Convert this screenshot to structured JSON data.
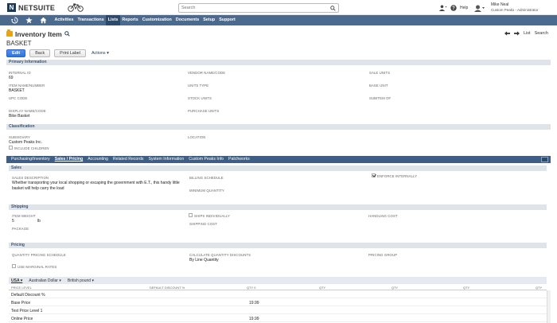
{
  "brand": {
    "name": "NETSUITE",
    "mark": "N"
  },
  "search": {
    "placeholder": "Search",
    "value": ""
  },
  "help": {
    "label": "Help"
  },
  "user": {
    "name": "Mike Neal",
    "role": "Custom Peaks - Administrator"
  },
  "nav": {
    "items": [
      "Activities",
      "Transactions",
      "Lists",
      "Reports",
      "Customization",
      "Documents",
      "Setup",
      "Support"
    ],
    "active": "Lists"
  },
  "page": {
    "title": "Inventory Item",
    "record_name": "BASKET",
    "list_link": "List",
    "search_link": "Search"
  },
  "buttons": {
    "edit": "Edit",
    "back": "Back",
    "print_label": "Print Label",
    "actions": "Actions ▾"
  },
  "primary": {
    "heading": "Primary Information",
    "internal_id_label": "INTERNAL ID",
    "internal_id_value": "69",
    "item_name_label": "ITEM NAME/NUMBER",
    "item_name_value": "BASKET",
    "upc_label": "UPC CODE",
    "display_name_label": "DISPLAY NAME/CODE",
    "display_name_value": "Bike Basket",
    "vendor_name_label": "VENDOR NAME/CODE",
    "units_type_label": "UNITS TYPE",
    "stock_units_label": "STOCK UNITS",
    "purchase_units_label": "PURCHASE UNITS",
    "sale_units_label": "SALE UNITS",
    "base_unit_label": "BASE UNIT",
    "subitem_of_label": "SUBITEM OF"
  },
  "classification": {
    "heading": "Classification",
    "subsidiary_label": "SUBSIDIARY",
    "subsidiary_value": "Custom Peaks Inc.",
    "include_children_label": "INCLUDE CHILDREN",
    "location_label": "LOCATION"
  },
  "subtabs": {
    "items": [
      "Purchasing/Inventory",
      "Sales / Pricing",
      "Accounting",
      "Related Records",
      "System Information",
      "Custom Peaks Info",
      "Patchworks"
    ],
    "active": "Sales / Pricing"
  },
  "sales": {
    "heading": "Sales",
    "description_label": "SALES DESCRIPTION",
    "description_line1": "Whether transporting your local shopping or escaping the government with E.T., this handy little",
    "description_line2": "basket will help carry the load",
    "billing_schedule_label": "BILLING SCHEDULE",
    "minimum_quantity_label": "MINIMUM QUANTITY",
    "enforce_internally_label": "ENFORCE INTERNALLY",
    "enforce_internally_checked": true
  },
  "shipping": {
    "heading": "Shipping",
    "item_weight_label": "ITEM WEIGHT",
    "item_weight_value": "5",
    "item_weight_unit": "lb",
    "package_label": "PACKAGE",
    "ships_individually_label": "SHIPS INDIVIDUALLY",
    "shipping_cost_label": "SHIPPING COST",
    "handling_cost_label": "HANDLING COST"
  },
  "pricing": {
    "heading": "Pricing",
    "schedule_label": "QUANTITY PRICING SCHEDULE",
    "marginal_rates_label": "USE MARGINAL RATES",
    "calc_discounts_label": "CALCULATE QUANTITY DISCOUNTS",
    "calc_discounts_value": "By Line Quantity",
    "group_label": "PRICING GROUP",
    "currencies": [
      "USA ▾",
      "Australian Dollar ▾",
      "British pound ▾"
    ],
    "columns": [
      "PRICE LEVEL",
      "DEFAULT DISCOUNT %",
      "QTY 0",
      "QTY",
      "QTY",
      "QTY",
      "QTY",
      "QTY"
    ],
    "rows": [
      {
        "level": "Default Discount %",
        "price": ""
      },
      {
        "level": "Base Price",
        "price": "19.99"
      },
      {
        "level": "Test Price Level 1",
        "price": ""
      },
      {
        "level": "Online Price",
        "price": "19.99"
      }
    ]
  },
  "colors": {
    "nav": "#4b6a8e",
    "subtabs": "#3f5e85",
    "section": "#dfe4eb",
    "primary_button": "#3074d5",
    "title_icon": "#e8a317"
  }
}
